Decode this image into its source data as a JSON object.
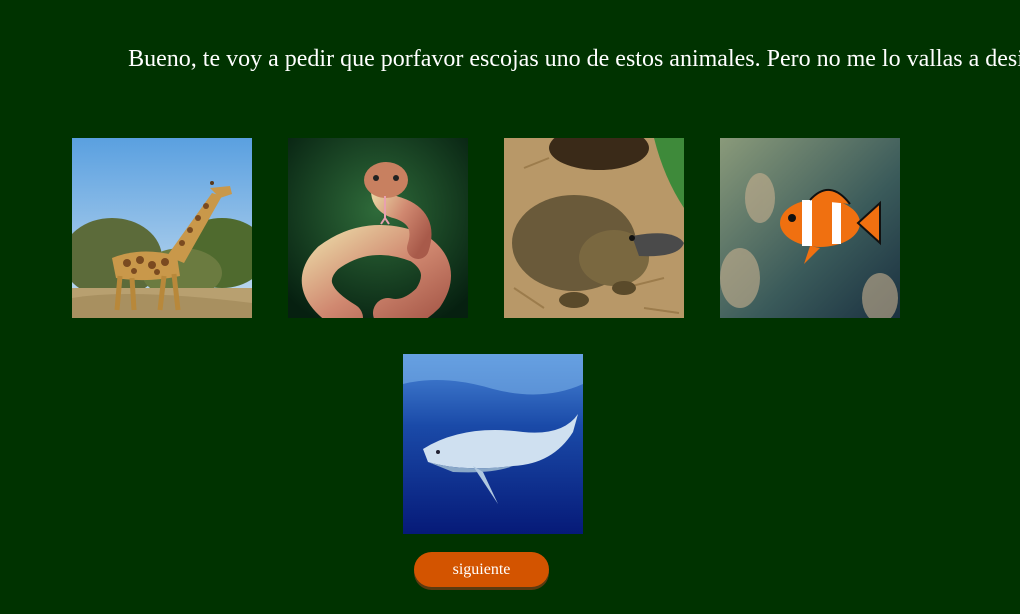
{
  "prompt": {
    "text": "Bueno, te voy a pedir que porfavor escojas uno de estos animales. Pero no me lo vallas a desir"
  },
  "animals": [
    {
      "name": "giraffe"
    },
    {
      "name": "snake"
    },
    {
      "name": "platypus"
    },
    {
      "name": "clownfish"
    },
    {
      "name": "whale"
    }
  ],
  "next_button": {
    "label": "siguiente"
  },
  "colors": {
    "background": "#003300",
    "button": "#d35400",
    "text": "#ffffff"
  }
}
